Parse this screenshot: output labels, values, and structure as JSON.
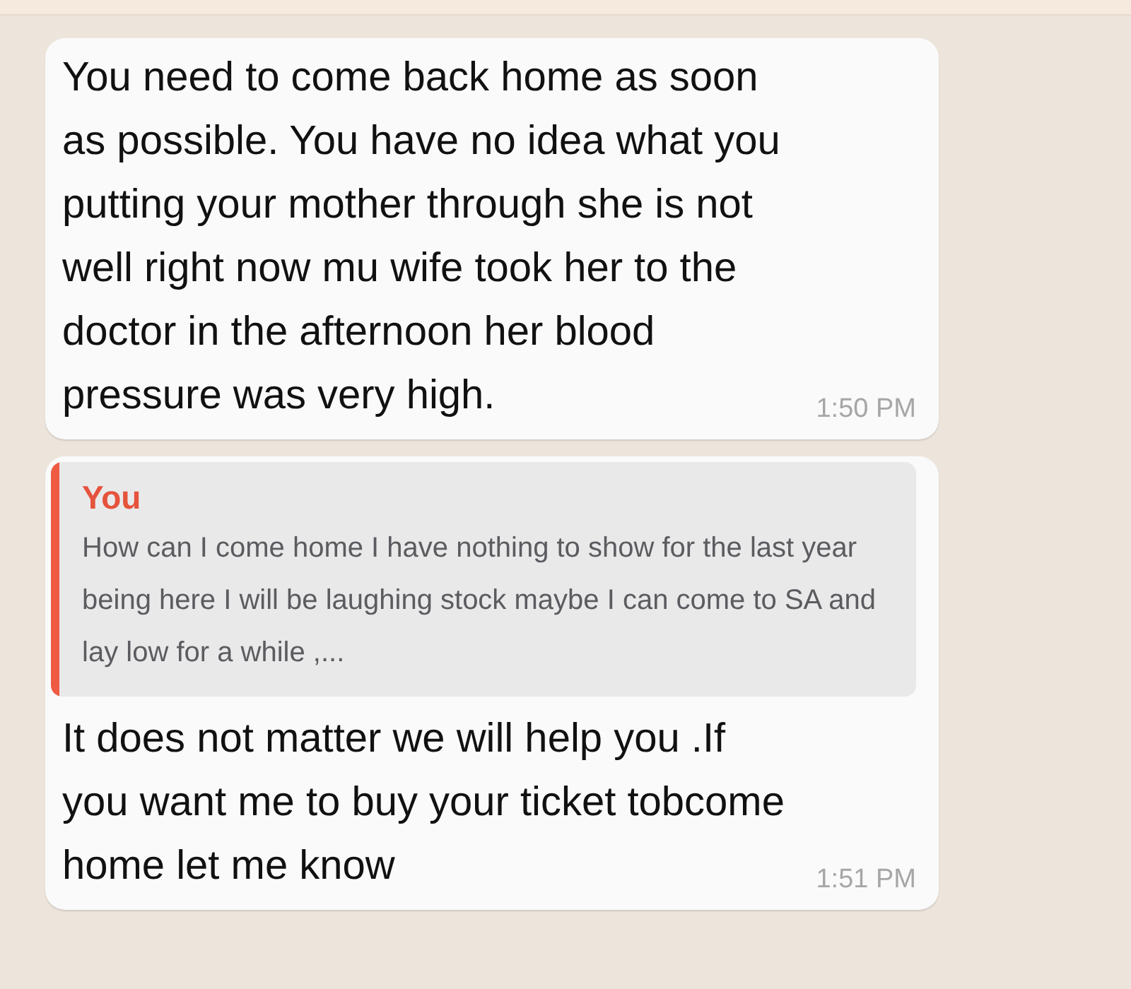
{
  "messages": [
    {
      "kind": "text",
      "text": "You need to come back home as soon as possible. You have no idea what you putting your mother through she is not well right now mu wife took her to the doctor in the afternoon her blood pressure was very high.",
      "time": "1:50 PM"
    },
    {
      "kind": "reply",
      "quote": {
        "author": "You",
        "text": "How can I come home I have nothing to show for the last year being here I will be laughing stock maybe I can come to SA and lay low for a while ,..."
      },
      "text": "It does not matter we will help you .If you want me to buy your ticket tobcome home let me know",
      "time": "1:51 PM"
    }
  ]
}
